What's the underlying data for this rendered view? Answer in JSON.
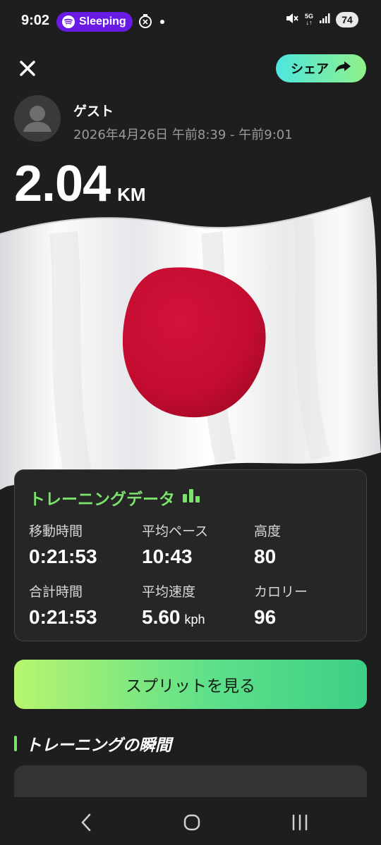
{
  "status_bar": {
    "time": "9:02",
    "media_app_label": "Sleeping",
    "network": "5G",
    "battery": "74"
  },
  "header": {
    "share_label": "シェア"
  },
  "workout": {
    "user_name": "ゲスト",
    "datetime": "2026年4月26日 午前8:39 - 午前9:01",
    "distance_value": "2.04",
    "distance_unit": "KM"
  },
  "training_data": {
    "title": "トレーニングデータ",
    "stats": [
      {
        "label": "移動時間",
        "value": "0:21:53",
        "unit": ""
      },
      {
        "label": "平均ペース",
        "value": "10:43",
        "unit": ""
      },
      {
        "label": "高度",
        "value": "80",
        "unit": ""
      },
      {
        "label": "合計時間",
        "value": "0:21:53",
        "unit": ""
      },
      {
        "label": "平均速度",
        "value": "5.60",
        "unit": "kph"
      },
      {
        "label": "カロリー",
        "value": "96",
        "unit": ""
      }
    ]
  },
  "split_button_label": "スプリットを見る",
  "moments_title": "トレーニングの瞬間",
  "colors": {
    "accent_green": "#7be36c",
    "spotify_purple": "#6a1be3",
    "flag_red": "#c8102e"
  },
  "icons": [
    "spotify-icon",
    "timer-icon",
    "mute-icon",
    "signal-icon",
    "close-icon",
    "share-arrow-icon",
    "user-avatar-icon",
    "bar-chart-icon",
    "back-icon",
    "home-icon",
    "recents-icon"
  ]
}
